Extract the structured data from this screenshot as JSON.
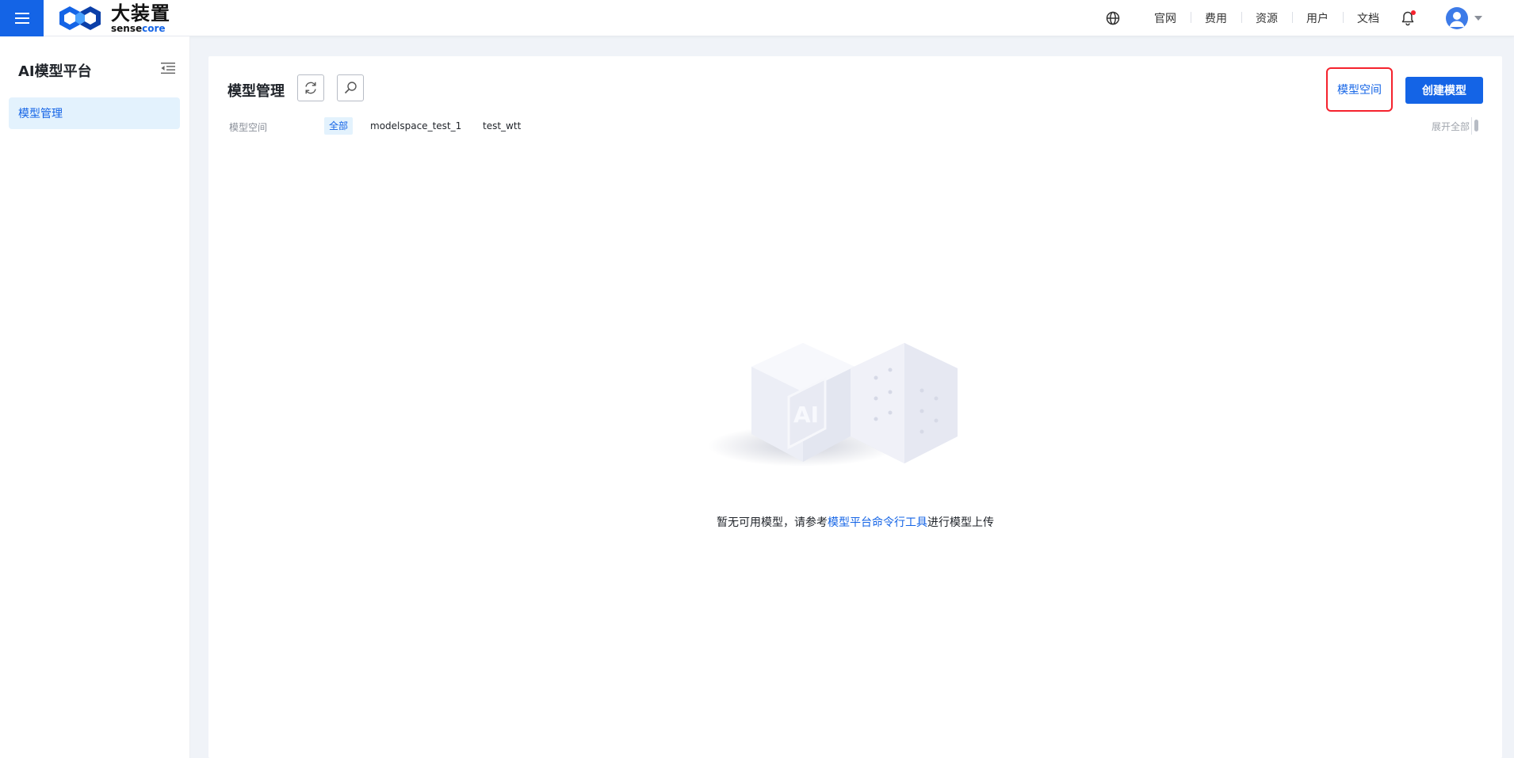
{
  "header": {
    "logo_cn": "大装置",
    "logo_en_sense": "sense",
    "logo_en_core": "core",
    "nav": [
      "官网",
      "费用",
      "资源",
      "用户",
      "文档"
    ],
    "icons": {
      "menu": "hamburger-icon",
      "globe": "globe-icon",
      "bell": "bell-icon",
      "avatar": "user-avatar-icon",
      "caret": "caret-down-icon"
    },
    "accent_color": "#1464e6",
    "notification_dot_color": "#f5222d"
  },
  "sidebar": {
    "title": "AI模型平台",
    "items": [
      {
        "label": "模型管理",
        "active": true
      }
    ]
  },
  "main": {
    "title": "模型管理",
    "buttons": {
      "model_space": "模型空间",
      "create_model": "创建模型"
    },
    "filters": {
      "label": "模型空间",
      "tags": [
        "全部",
        "modelspace_test_1",
        "test_wtt"
      ],
      "active_index": 0,
      "expand_all": "展开全部"
    },
    "empty": {
      "prefix": "暂无可用模型，请参考",
      "link": "模型平台命令行工具",
      "suffix": "进行模型上传",
      "illustration_text": "AI"
    }
  }
}
